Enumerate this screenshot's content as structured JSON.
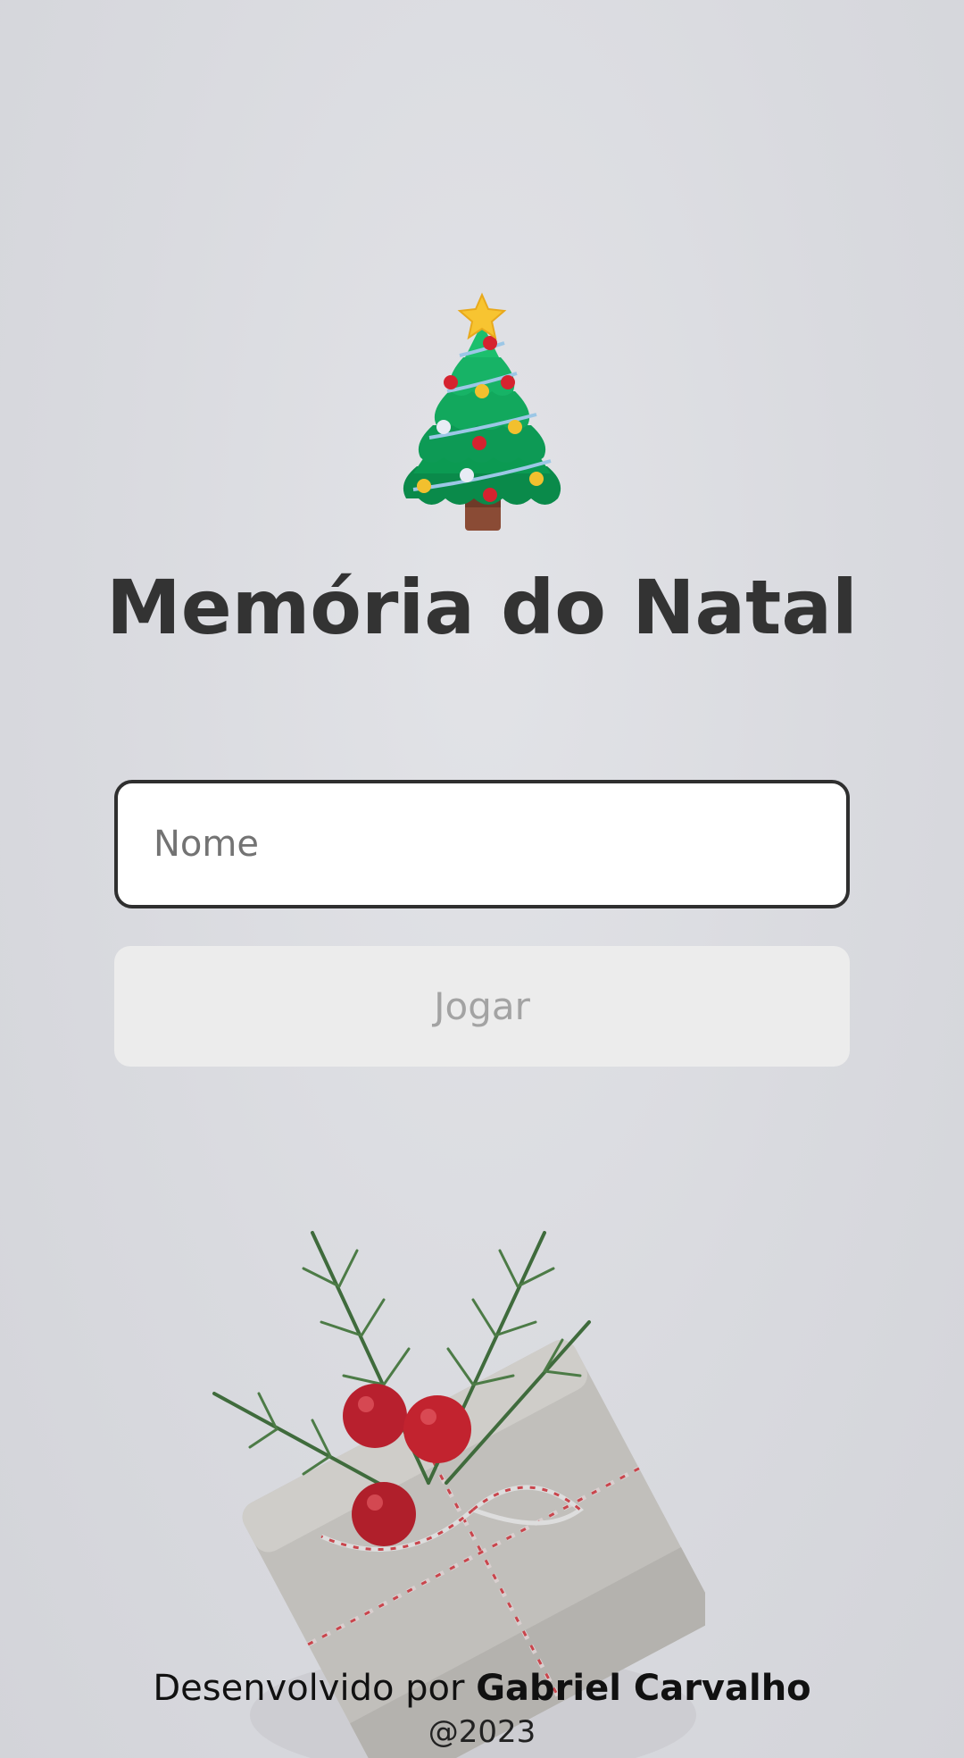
{
  "header": {
    "icon": "christmas-tree-icon",
    "title": "Memória do Natal"
  },
  "form": {
    "name_placeholder": "Nome",
    "name_value": "",
    "play_label": "Jogar"
  },
  "decoration": {
    "image": "christmas-gift-illustration"
  },
  "footer": {
    "credit_prefix": "Desenvolvido por",
    "author": "Gabriel Carvalho",
    "year": "@2023"
  },
  "colors": {
    "background": "#dadbe0",
    "title_text": "#333333",
    "input_border": "#2f2f2f",
    "button_background": "#ececec",
    "button_text": "#a3a3a3"
  }
}
